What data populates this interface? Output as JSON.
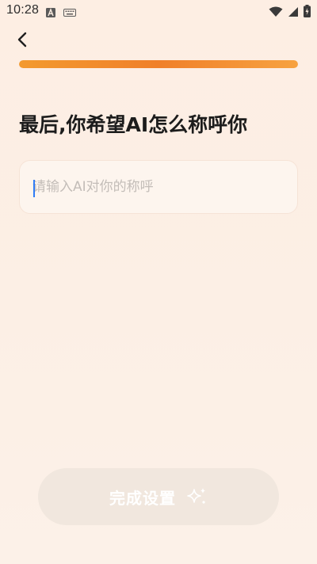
{
  "status_bar": {
    "time": "10:28",
    "icons": [
      "a-notification-icon",
      "keyboard-icon",
      "wifi-icon",
      "signal-icon",
      "battery-icon"
    ]
  },
  "nav": {
    "back_icon": "chevron-left-icon"
  },
  "progress": {
    "value": 1.0,
    "colors": {
      "start": "#f39a2f",
      "end": "#f7a240"
    }
  },
  "main": {
    "title": "最后,你希望AI怎么称呼你",
    "name_input": {
      "value": "",
      "placeholder": "请输入AI对你的称呼"
    }
  },
  "footer": {
    "finish_label": "完成设置",
    "finish_icon": "sparkle-icon",
    "finish_enabled": false
  }
}
